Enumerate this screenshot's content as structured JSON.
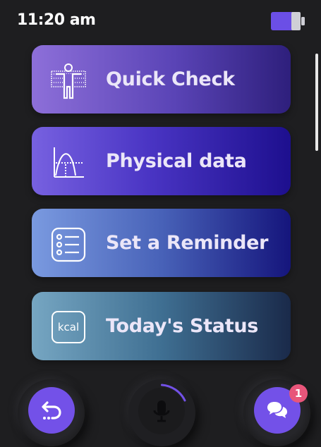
{
  "status_bar": {
    "time": "11:20 am",
    "battery_icon": "battery-icon"
  },
  "menu": {
    "items": [
      {
        "label": "Quick Check",
        "icon": "body-scan-icon"
      },
      {
        "label": "Physical data",
        "icon": "chart-curve-icon"
      },
      {
        "label": "Set a Reminder",
        "icon": "list-icon"
      },
      {
        "label": "Today's Status",
        "icon": "kcal-icon",
        "icon_text": "kcal"
      }
    ]
  },
  "bottom_bar": {
    "back_icon": "undo-icon",
    "mic_icon": "microphone-icon",
    "chat_icon": "chat-bubbles-icon",
    "chat_badge": "1"
  },
  "colors": {
    "background": "#1e1e20",
    "accent": "#7351e8",
    "badge": "#e8557a"
  }
}
